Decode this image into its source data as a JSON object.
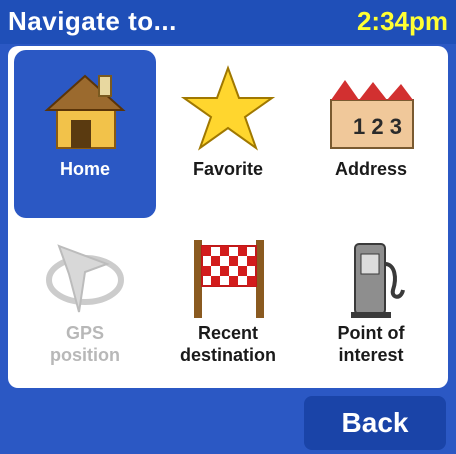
{
  "header": {
    "title": "Navigate to...",
    "time": "2:34pm"
  },
  "menu": {
    "items": [
      {
        "label": "Home"
      },
      {
        "label": "Favorite"
      },
      {
        "label": "Address",
        "number_glyphs": "1 2 3"
      },
      {
        "label_line1": "GPS",
        "label_line2": "position"
      },
      {
        "label_line1": "Recent",
        "label_line2": "destination"
      },
      {
        "label_line1": "Point of",
        "label_line2": "interest"
      }
    ]
  },
  "footer": {
    "back_label": "Back"
  },
  "colors": {
    "accent": "#2b58c4",
    "clock": "#ffff33"
  }
}
